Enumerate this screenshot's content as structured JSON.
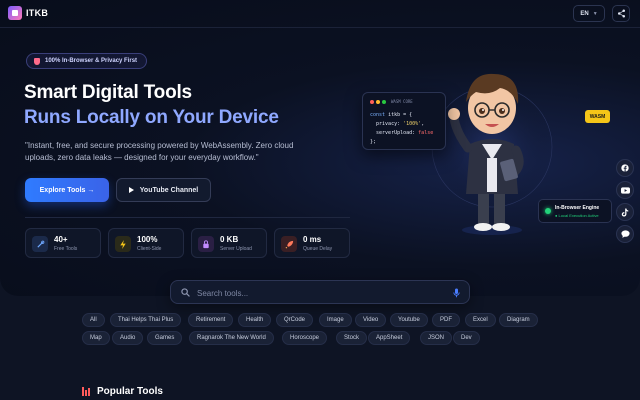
{
  "header": {
    "brand": "ITKB",
    "lang": "EN"
  },
  "hero": {
    "badge": "100% In-Browser & Privacy First",
    "title_line1": "Smart Digital Tools",
    "title_line2": "Runs Locally on Your Device",
    "description": "\"Instant, free, and secure processing powered by WebAssembly. Zero cloud uploads, zero data leaks — designed for your everyday workflow.\"",
    "primary_button": "Explore Tools →",
    "secondary_button": "YouTube Channel",
    "stats": [
      {
        "value": "40+",
        "label": "Free Tools",
        "icon": "tools-icon",
        "color": "#6fa8ff"
      },
      {
        "value": "100%",
        "label": "Client-Side",
        "icon": "bolt-icon",
        "color": "#f5c518"
      },
      {
        "value": "0 KB",
        "label": "Server Upload",
        "icon": "lock-icon",
        "color": "#c28bff"
      },
      {
        "value": "0 ms",
        "label": "Queue Delay",
        "icon": "rocket-icon",
        "color": "#ff7a5c"
      }
    ]
  },
  "code_card": {
    "title": "WASM CORE",
    "line1_kw": "const",
    "line1_rest": " itkb = {",
    "line2_key": "  privacy: ",
    "line2_val": "'100%'",
    "line2_end": ",",
    "line3_key": "  serverUpload: ",
    "line3_val": "false",
    "line4": "};"
  },
  "wasm_tag": "WASM",
  "engine": {
    "title": "In-Browser Engine",
    "status": "● Local Execution Active"
  },
  "social": [
    "facebook-icon",
    "youtube-icon",
    "tiktok-icon",
    "chat-icon"
  ],
  "search": {
    "placeholder": "Search tools..."
  },
  "categories": {
    "row1": [
      "All",
      "Thai Helps Thai Plus",
      "Retirement",
      "Health",
      "QrCode",
      "Image",
      "Video",
      "Youtube",
      "PDF",
      "Excel",
      "Diagram"
    ],
    "row2": [
      "Map",
      "Audio",
      "Games",
      "Ragnarok The New World",
      "Horoscope",
      "Stock",
      "AppSheet",
      "JSON",
      "Dev"
    ]
  },
  "popular": {
    "title": "Popular Tools"
  },
  "colors": {
    "accent": "#2f7bff",
    "title_gradient": "#8fa8ff",
    "engine_green": "#22d37a",
    "wasm_yellow": "#f5c518"
  }
}
